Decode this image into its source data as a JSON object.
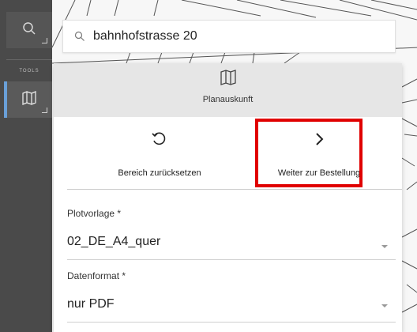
{
  "toolbar": {
    "tools_label": "TOOLS",
    "icons": [
      "search-icon",
      "map-icon"
    ],
    "accent_color": "#6aa0d8"
  },
  "search": {
    "value": "bahnhofstrasse 20"
  },
  "panel": {
    "title": "Planauskunft",
    "actions": {
      "reset_label": "Bereich zurücksetzen",
      "next_label": "Weiter zur Bestellung"
    },
    "highlight_color": "#e00000",
    "fields": {
      "plot_label": "Plotvorlage *",
      "plot_value": "02_DE_A4_quer",
      "format_label": "Datenformat *",
      "format_value": "nur PDF"
    }
  }
}
